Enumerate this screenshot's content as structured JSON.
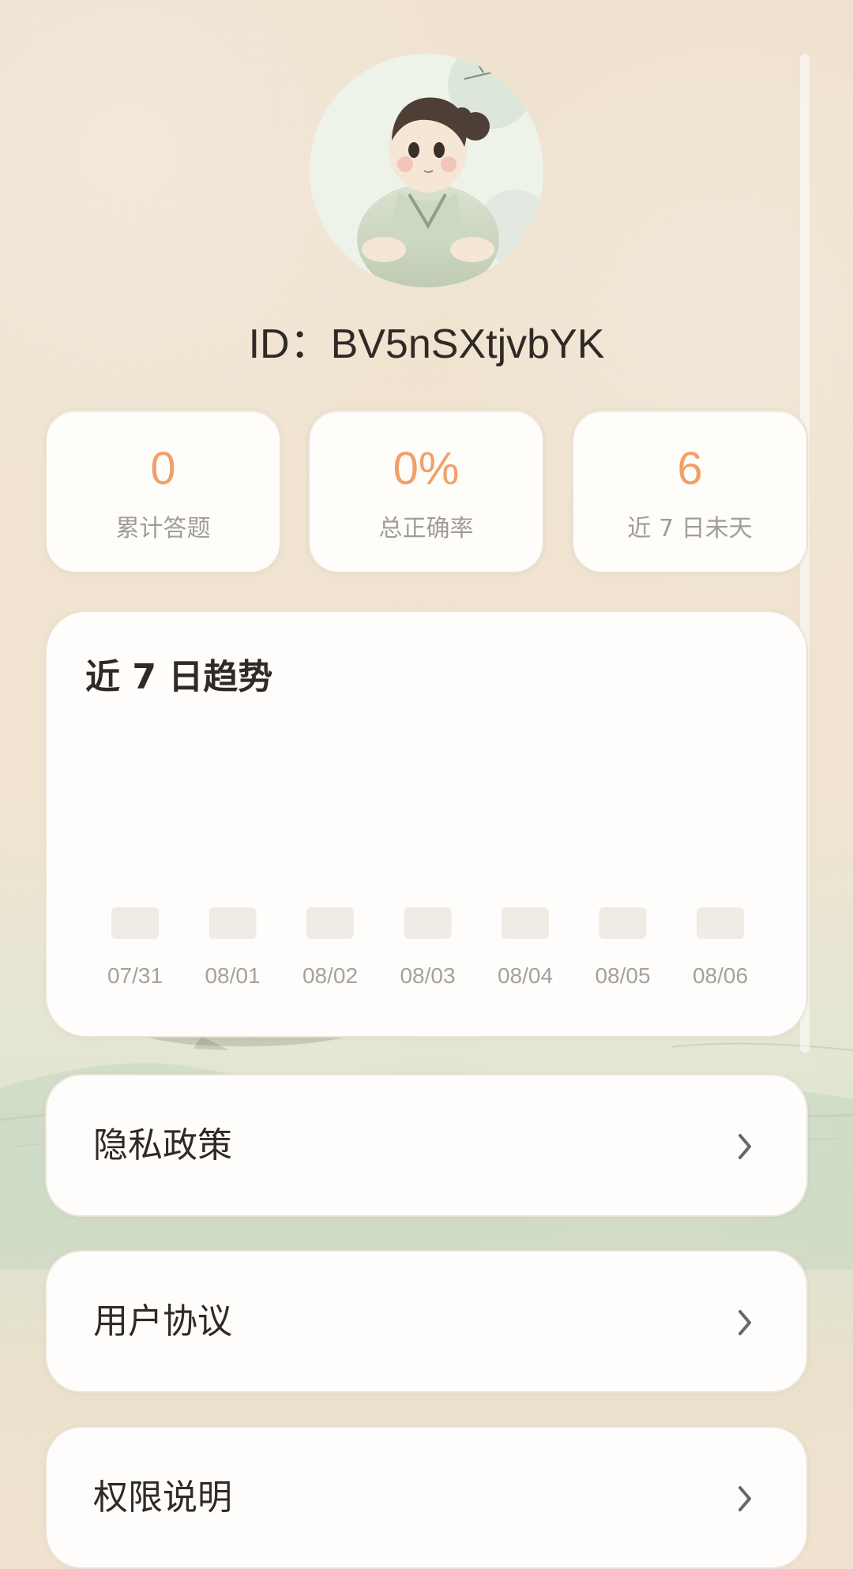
{
  "profile": {
    "id_text": "ID：BV5nSXtjvbYK"
  },
  "stats": [
    {
      "value": "0",
      "label": "累计答题"
    },
    {
      "value": "0%",
      "label": "总正确率"
    },
    {
      "value": "6",
      "label": "近 7 日未天"
    }
  ],
  "trend": {
    "title": "近 7 日趋势"
  },
  "chart_data": {
    "type": "bar",
    "title": "近 7 日趋势",
    "categories": [
      "07/31",
      "08/01",
      "08/02",
      "08/03",
      "08/04",
      "08/05",
      "08/06"
    ],
    "values": [
      0,
      0,
      0,
      0,
      0,
      0,
      0
    ],
    "xlabel": "",
    "ylabel": "",
    "grid": false,
    "legend": "none"
  },
  "menu": [
    {
      "label": "隐私政策"
    },
    {
      "label": "用户协议"
    },
    {
      "label": "权限说明"
    }
  ],
  "colors": {
    "accent": "#f0a06b",
    "text_primary": "#2f2a25",
    "text_secondary": "#a09d99",
    "card_bg": "#fffdfb",
    "bar_placeholder": "#efebe5"
  },
  "icons": {
    "menu_arrow": "chevron-right-icon"
  }
}
